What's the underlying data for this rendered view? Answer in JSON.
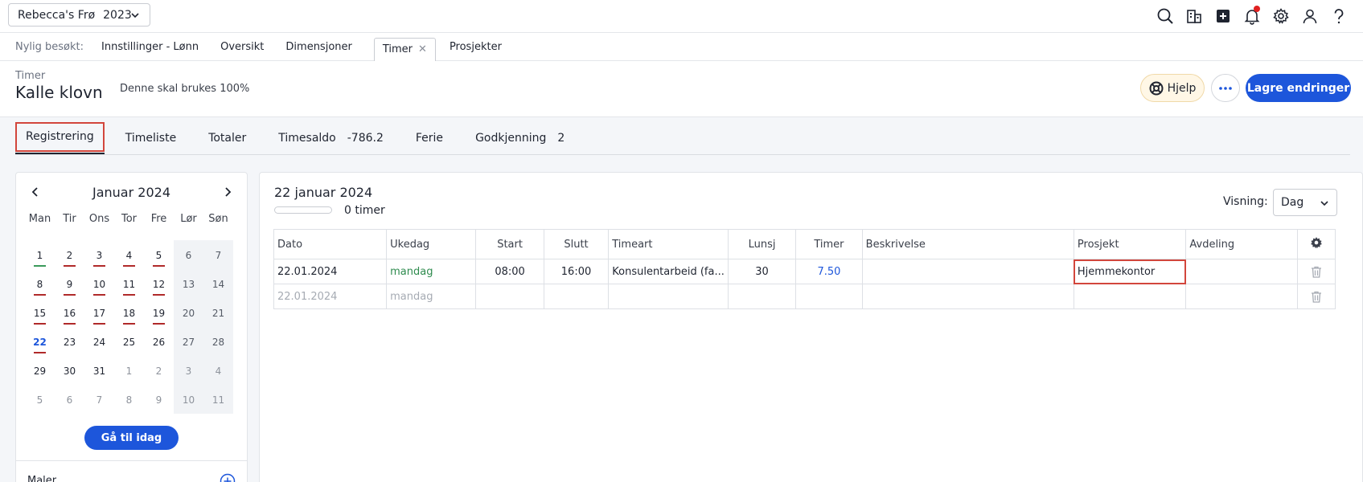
{
  "topbar": {
    "company": "Rebecca's Frø",
    "year": "2023",
    "icons": [
      "search-icon",
      "building-icon",
      "plus-square-icon",
      "bell-icon",
      "gear-icon",
      "user-icon",
      "help-icon"
    ]
  },
  "recent": {
    "label": "Nylig besøkt:",
    "items": [
      "Innstillinger - Lønn",
      "Oversikt",
      "Dimensjoner"
    ],
    "active_tab": "Timer",
    "after": "Prosjekter"
  },
  "header": {
    "crumb": "Timer",
    "title": "Kalle klovn",
    "subtitle": "Denne skal brukes 100%",
    "help_label": "Hjelp",
    "save_label": "Lagre endringer"
  },
  "tabs": {
    "registrering": "Registrering",
    "timeliste": "Timeliste",
    "totaler": "Totaler",
    "timesaldo": "Timesaldo",
    "timesaldo_value": "-786.2",
    "ferie": "Ferie",
    "godkjenning": "Godkjenning",
    "godkjenning_count": "2"
  },
  "calendar": {
    "month": "Januar 2024",
    "dow": [
      "Man",
      "Tir",
      "Ons",
      "Tor",
      "Fre",
      "Lør",
      "Søn"
    ],
    "weeks": [
      [
        "1",
        "2",
        "3",
        "4",
        "5",
        "6",
        "7"
      ],
      [
        "8",
        "9",
        "10",
        "11",
        "12",
        "13",
        "14"
      ],
      [
        "15",
        "16",
        "17",
        "18",
        "19",
        "20",
        "21"
      ],
      [
        "22",
        "23",
        "24",
        "25",
        "26",
        "27",
        "28"
      ],
      [
        "29",
        "30",
        "31",
        "1",
        "2",
        "3",
        "4"
      ],
      [
        "5",
        "6",
        "7",
        "8",
        "9",
        "10",
        "11"
      ]
    ],
    "today_label": "Gå til idag",
    "templates_label": "Maler"
  },
  "main": {
    "date_title": "22 januar 2024",
    "progress_fraction": 0,
    "progress_text": "0 timer",
    "view_label": "Visning:",
    "view_value": "Dag",
    "columns": [
      "Dato",
      "Ukedag",
      "Start",
      "Slutt",
      "Timeart",
      "Lunsj",
      "Timer",
      "Beskrivelse",
      "Prosjekt",
      "Avdeling"
    ],
    "rows": [
      {
        "dato": "22.01.2024",
        "ukedag": "mandag",
        "start": "08:00",
        "slutt": "16:00",
        "timeart": "Konsulentarbeid (fa...",
        "lunsj": "30",
        "timer": "7.50",
        "beskrivelse": "",
        "prosjekt": "Hjemmekontor",
        "avdeling": ""
      },
      {
        "dato": "22.01.2024",
        "ukedag": "mandag",
        "start": "",
        "slutt": "",
        "timeart": "",
        "lunsj": "",
        "timer": "",
        "beskrivelse": "",
        "prosjekt": "",
        "avdeling": ""
      }
    ]
  }
}
